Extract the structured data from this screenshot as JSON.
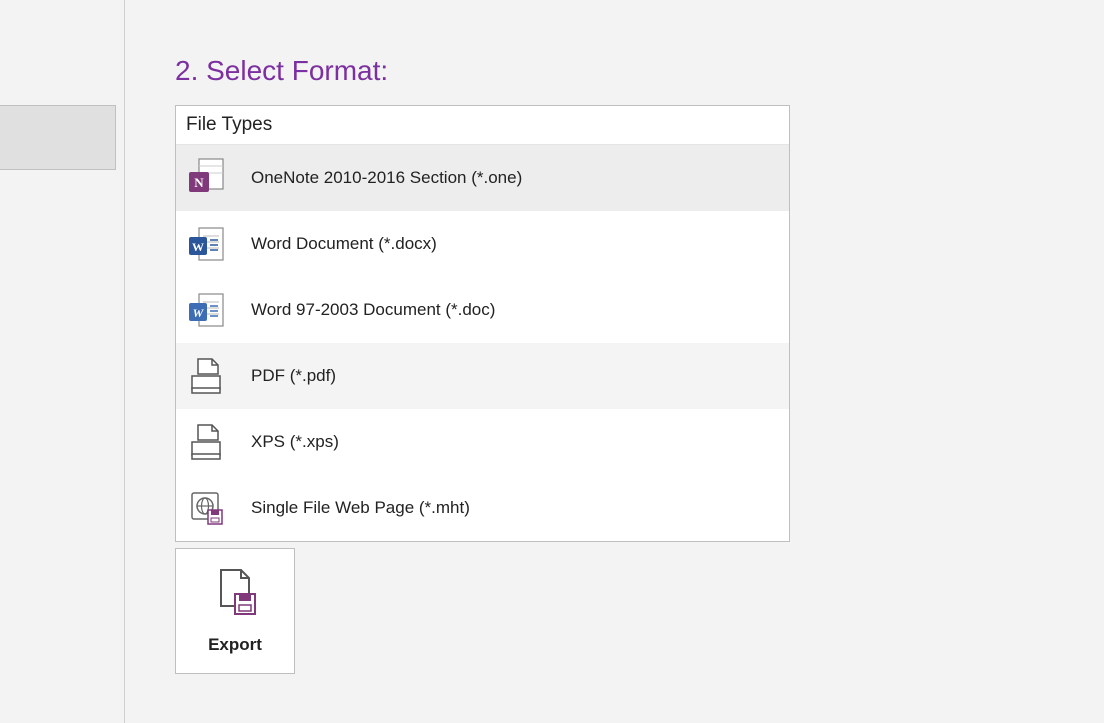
{
  "heading": "2. Select Format:",
  "panel": {
    "header": "File Types",
    "items": [
      {
        "label": "OneNote 2010-2016 Section (*.one)"
      },
      {
        "label": "Word Document (*.docx)"
      },
      {
        "label": "Word 97-2003 Document (*.doc)"
      },
      {
        "label": "PDF (*.pdf)"
      },
      {
        "label": "XPS (*.xps)"
      },
      {
        "label": "Single File Web Page (*.mht)"
      }
    ]
  },
  "export": {
    "label": "Export"
  }
}
